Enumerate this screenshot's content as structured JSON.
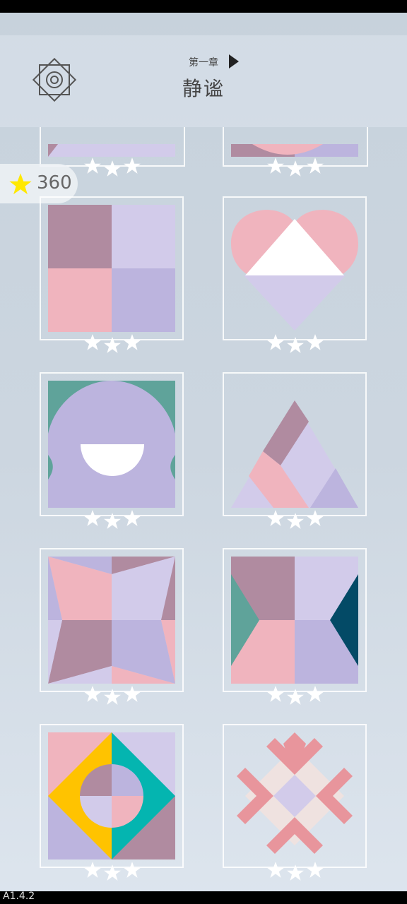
{
  "header": {
    "chapter_label": "第一章",
    "title": "静谧"
  },
  "score": {
    "value": "360",
    "icon": "star-icon"
  },
  "settings": {
    "icon": "gear-icon"
  },
  "version": "A1.4.2",
  "levels": [
    {
      "id": "level-1",
      "stars": 3
    },
    {
      "id": "level-2",
      "stars": 3
    },
    {
      "id": "level-3",
      "stars": 3
    },
    {
      "id": "level-4",
      "stars": 3
    },
    {
      "id": "level-5",
      "stars": 3
    },
    {
      "id": "level-6",
      "stars": 3
    },
    {
      "id": "level-7",
      "stars": 3
    },
    {
      "id": "level-8",
      "stars": 3
    },
    {
      "id": "level-9",
      "stars": 3
    },
    {
      "id": "level-10",
      "stars": 3
    }
  ],
  "colors": {
    "mauve": "#b08ba0",
    "lilac": "#d2cbea",
    "pink": "#f0b4be",
    "lavender": "#bcb4de",
    "teal": "#5fa39a",
    "navy": "#034a66",
    "yellow": "#ffc300",
    "cyan": "#04b5b0",
    "coral": "#e8959c"
  }
}
